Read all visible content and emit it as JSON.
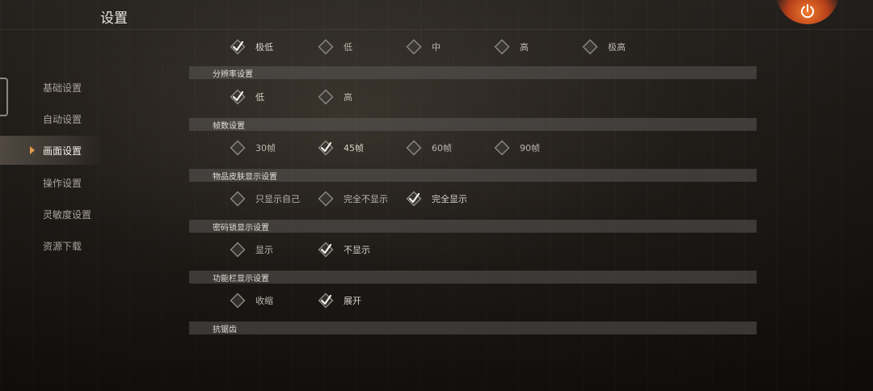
{
  "title": "设置",
  "power_icon": "power-icon",
  "sidebar": {
    "items": [
      {
        "label": "基础设置",
        "active": false
      },
      {
        "label": "自动设置",
        "active": false
      },
      {
        "label": "画面设置",
        "active": true
      },
      {
        "label": "操作设置",
        "active": false
      },
      {
        "label": "灵敏度设置",
        "active": false
      },
      {
        "label": "资源下载",
        "active": false
      }
    ]
  },
  "quality_row": {
    "options": [
      {
        "label": "极低",
        "checked": true
      },
      {
        "label": "低",
        "checked": false
      },
      {
        "label": "中",
        "checked": false
      },
      {
        "label": "高",
        "checked": false
      },
      {
        "label": "极高",
        "checked": false
      }
    ]
  },
  "sections": [
    {
      "header": "分辨率设置",
      "options": [
        {
          "label": "低",
          "checked": true
        },
        {
          "label": "高",
          "checked": false
        }
      ]
    },
    {
      "header": "帧数设置",
      "options": [
        {
          "label": "30帧",
          "checked": false
        },
        {
          "label": "45帧",
          "checked": true
        },
        {
          "label": "60帧",
          "checked": false
        },
        {
          "label": "90帧",
          "checked": false
        }
      ]
    },
    {
      "header": "物品皮肤显示设置",
      "options": [
        {
          "label": "只显示自己",
          "checked": false
        },
        {
          "label": "完全不显示",
          "checked": false
        },
        {
          "label": "完全显示",
          "checked": true
        }
      ]
    },
    {
      "header": "密码锁显示设置",
      "options": [
        {
          "label": "显示",
          "checked": false
        },
        {
          "label": "不显示",
          "checked": true
        }
      ]
    },
    {
      "header": "功能栏显示设置",
      "options": [
        {
          "label": "收缩",
          "checked": false
        },
        {
          "label": "展开",
          "checked": true
        }
      ]
    },
    {
      "header": "抗锯齿",
      "options": []
    }
  ],
  "colors": {
    "accent": "#e39a4a",
    "power": "#f07a2d"
  }
}
